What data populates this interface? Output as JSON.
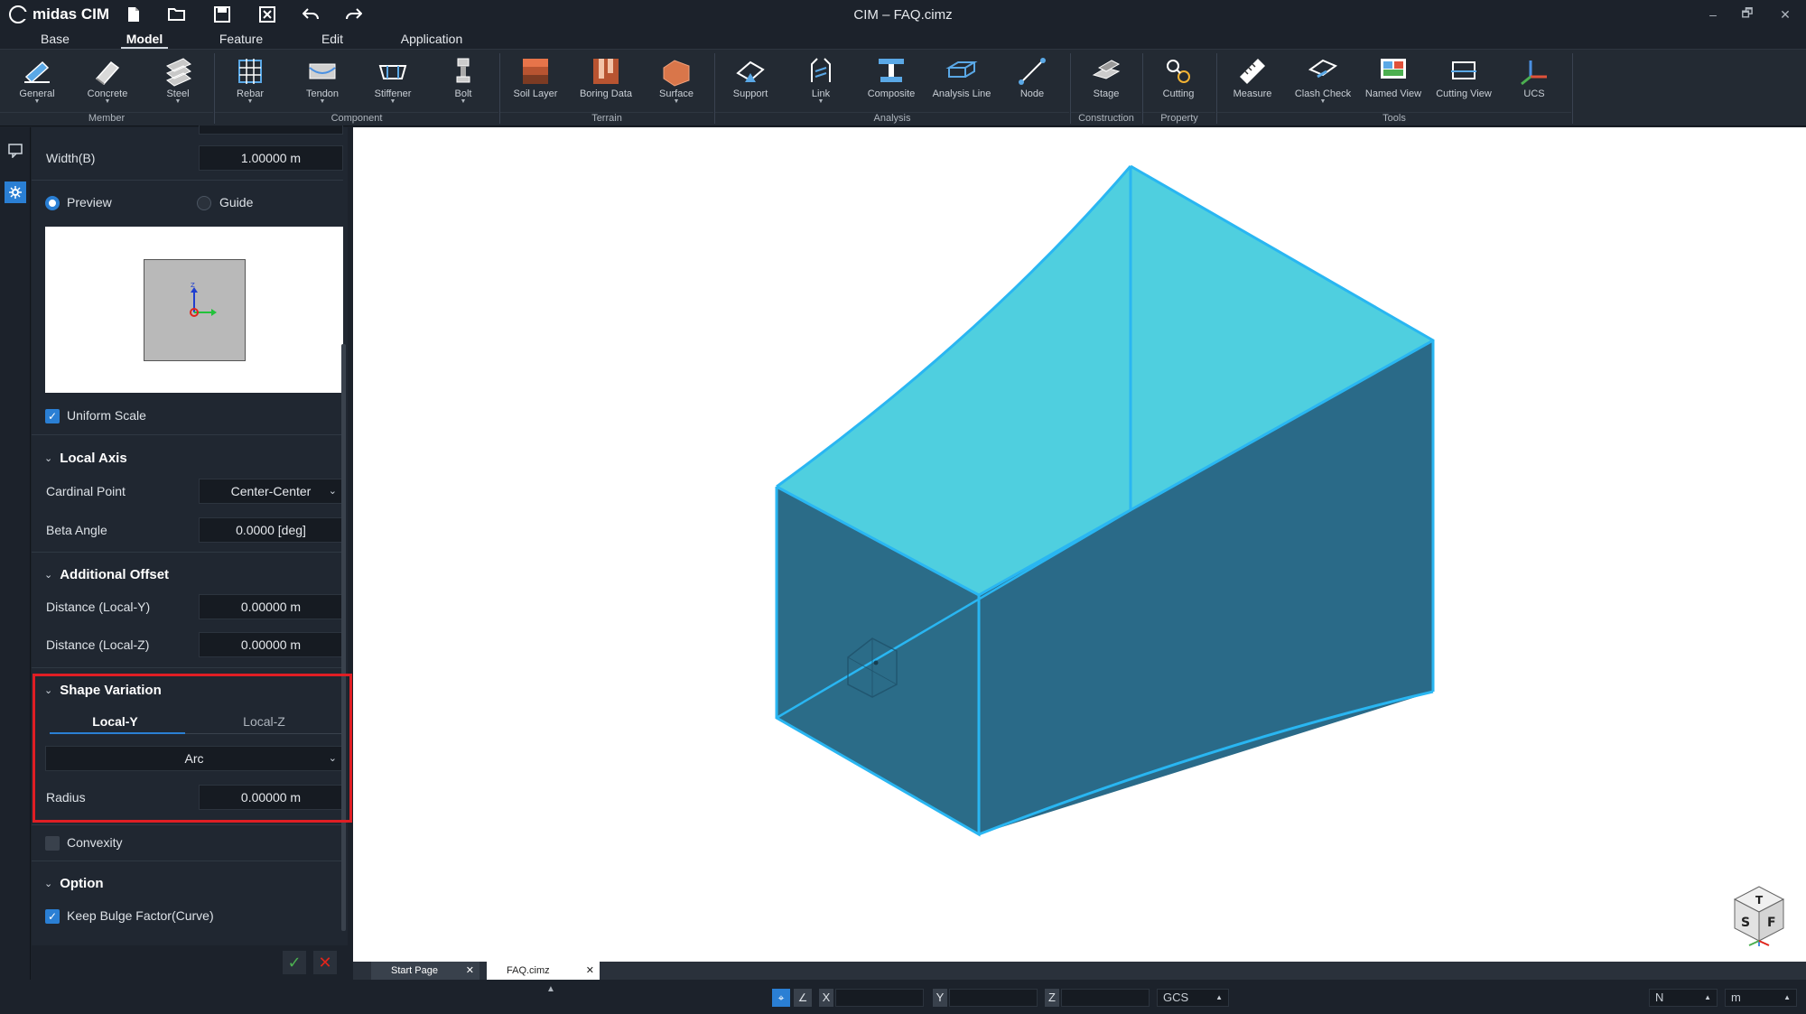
{
  "app": {
    "logo_text": "midas CIM",
    "window_title": "CIM – FAQ.cimz",
    "window_controls": [
      "–",
      "🗗",
      "✕"
    ]
  },
  "menu": {
    "tabs": [
      "Base",
      "Model",
      "Feature",
      "Edit",
      "Application"
    ],
    "active": "Model"
  },
  "ribbon": {
    "buttons": [
      "General",
      "Concrete",
      "Steel",
      "Rebar",
      "Tendon",
      "Stiffener",
      "Bolt",
      "Soil Layer",
      "Boring Data",
      "Surface",
      "Support",
      "Link",
      "Composite",
      "Analysis Line",
      "Node",
      "Stage",
      "Cutting",
      "Measure",
      "Clash Check",
      "Named View",
      "Cutting View",
      "UCS"
    ],
    "groups": [
      "Member",
      "Component",
      "Terrain",
      "Analysis",
      "Construction",
      "Property",
      "Tools"
    ]
  },
  "panel": {
    "width_label": "Width(B)",
    "width_value": "1.00000 m",
    "preview_label": "Preview",
    "guide_label": "Guide",
    "uniform_scale_label": "Uniform Scale",
    "local_axis": {
      "title": "Local Axis",
      "cardinal_point_label": "Cardinal Point",
      "cardinal_point_value": "Center-Center",
      "beta_angle_label": "Beta Angle",
      "beta_angle_value": "0.0000 [deg]"
    },
    "additional_offset": {
      "title": "Additional Offset",
      "dist_y_label": "Distance (Local-Y)",
      "dist_y_value": "0.00000 m",
      "dist_z_label": "Distance (Local-Z)",
      "dist_z_value": "0.00000 m"
    },
    "shape_variation": {
      "title": "Shape Variation",
      "tab_y": "Local-Y",
      "tab_z": "Local-Z",
      "type_value": "Arc",
      "radius_label": "Radius",
      "radius_value": "0.00000 m"
    },
    "convexity_label": "Convexity",
    "option": {
      "title": "Option",
      "keep_bulge_label": "Keep Bulge Factor(Curve)"
    }
  },
  "doc_tabs": [
    "Start Page",
    "FAQ.cimz"
  ],
  "status": {
    "x_label": "X",
    "y_label": "Y",
    "z_label": "Z",
    "coord_system": "GCS",
    "force_unit": "N",
    "length_unit": "m"
  },
  "viewcube": {
    "top": "T",
    "left": "S",
    "right": "F"
  },
  "colors": {
    "accent": "#2a7fd4",
    "highlight_box": "#e01e24",
    "solid_top": "#4ecfe0",
    "solid_side": "#2a6d8c",
    "edge": "#29b6f2"
  }
}
